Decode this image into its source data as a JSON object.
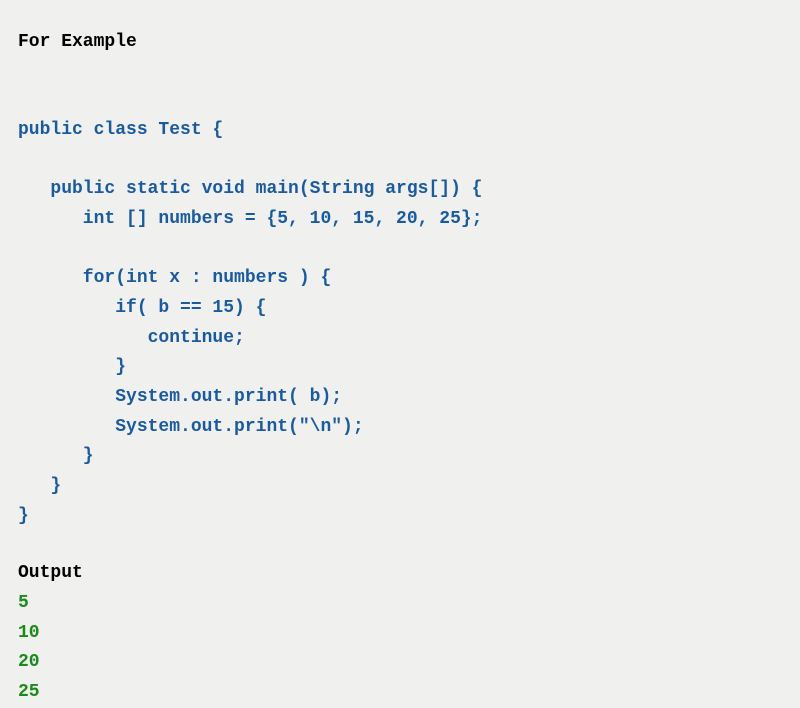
{
  "heading": "For Example",
  "code": "public class Test {\n\n   public static void main(String args[]) {\n      int [] numbers = {5, 10, 15, 20, 25};\n\n      for(int x : numbers ) {\n         if( b == 15) {\n            continue;\n         }\n         System.out.print( b);\n         System.out.print(\"\\n\");\n      }\n   }\n}",
  "output_label": "Output",
  "output": "5\n10\n20\n25"
}
